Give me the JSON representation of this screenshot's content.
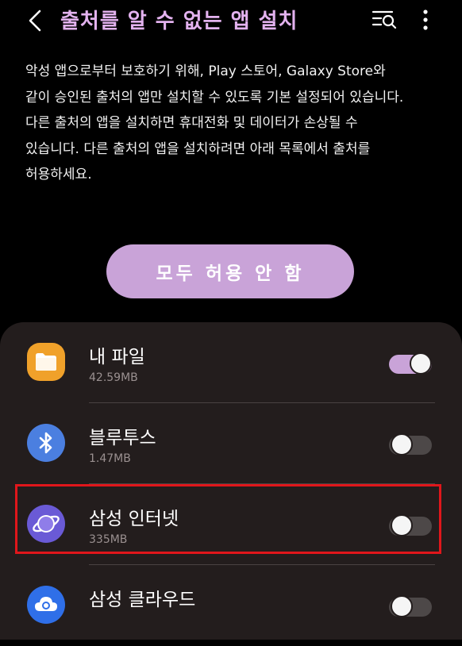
{
  "header": {
    "title": "출처를 알 수 없는 앱 설치"
  },
  "description": {
    "lines": [
      "악성 앱으로부터 보호하기 위해, Play 스토어, Galaxy Store와",
      "같이 승인된 출처의 앱만 설치할 수 있도록 기본 설정되어 있습니다.",
      "다른 출처의 앱을 설치하면 휴대전화 및 데이터가 손상될 수",
      "있습니다. 다른 출처의 앱을 설치하려면 아래 목록에서 출처를",
      "허용하세요."
    ]
  },
  "allow_all_button": {
    "label": "모두 허용 안 함"
  },
  "apps": [
    {
      "name": "내 파일",
      "size": "42.59MB",
      "enabled": true,
      "icon": "folder-icon",
      "color": "#f0a12a"
    },
    {
      "name": "블루투스",
      "size": "1.47MB",
      "enabled": false,
      "icon": "bluetooth-icon",
      "color": "#4b7fe0"
    },
    {
      "name": "삼성 인터넷",
      "size": "335MB",
      "enabled": false,
      "icon": "samsung-internet-icon",
      "color": "#6a5ad6"
    },
    {
      "name": "삼성 클라우드",
      "size": "",
      "enabled": false,
      "icon": "samsung-cloud-icon",
      "color": "#2f6fe8"
    }
  ],
  "colors": {
    "accent": "#c9a3d8",
    "title": "#e3b2ef",
    "highlight": "#e0161b",
    "card": "#231d1d"
  }
}
